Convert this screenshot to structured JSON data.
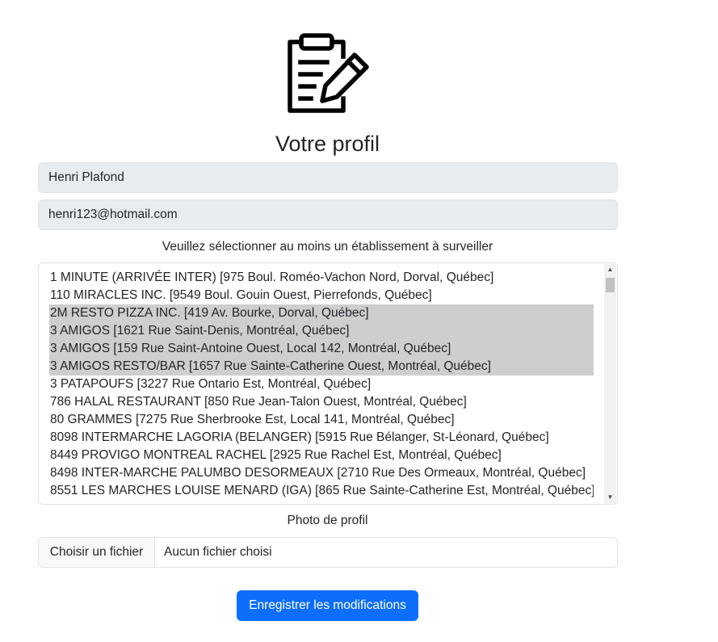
{
  "page": {
    "title": "Votre profil"
  },
  "form": {
    "name_value": "Henri Plafond",
    "email_value": "henri123@hotmail.com",
    "establishments_hint": "Veuillez sélectionner au moins un établissement à surveiller",
    "establishments": [
      {
        "label": "1 MINUTE (ARRIVÉE INTER) [975 Boul. Roméo-Vachon Nord, Dorval, Québec]",
        "selected": false
      },
      {
        "label": "110 MIRACLES INC. [9549 Boul. Gouin Ouest, Pierrefonds, Québec]",
        "selected": false
      },
      {
        "label": "2M RESTO PIZZA INC. [419 Av. Bourke, Dorval, Québec]",
        "selected": true
      },
      {
        "label": "3 AMIGOS [1621 Rue Saint-Denis, Montréal, Québec]",
        "selected": true
      },
      {
        "label": "3 AMIGOS [159 Rue Saint-Antoine Ouest, Local 142, Montréal, Québec]",
        "selected": true
      },
      {
        "label": "3 AMIGOS RESTO/BAR [1657 Rue Sainte-Catherine Ouest, Montréal, Québec]",
        "selected": true
      },
      {
        "label": "3 PATAPOUFS [3227 Rue Ontario Est, Montréal, Québec]",
        "selected": false
      },
      {
        "label": "786 HALAL RESTAURANT [850 Rue Jean-Talon Ouest, Montréal, Québec]",
        "selected": false
      },
      {
        "label": "80 GRAMMES [7275 Rue Sherbrooke Est, Local 141, Montréal, Québec]",
        "selected": false
      },
      {
        "label": "8098 INTERMARCHE LAGORIA (BELANGER) [5915 Rue Bélanger, St-Léonard, Québec]",
        "selected": false
      },
      {
        "label": "8449 PROVIGO MONTREAL RACHEL [2925 Rue Rachel Est, Montréal, Québec]",
        "selected": false
      },
      {
        "label": "8498 INTER-MARCHE PALUMBO DESORMEAUX [2710 Rue Des Ormeaux, Montréal, Québec]",
        "selected": false
      },
      {
        "label": "8551 LES MARCHES LOUISE MENARD (IGA) [865 Rue Sainte-Catherine Est, Montréal, Québec]",
        "selected": false
      }
    ],
    "photo_label": "Photo de profil",
    "file_button_label": "Choisir un fichier",
    "file_status": "Aucun fichier choisi",
    "save_label": "Enregistrer les modifications"
  },
  "icons": {
    "logo": "clipboard-edit-icon",
    "scroll_up": "triangle-up-icon",
    "scroll_down": "triangle-down-icon"
  },
  "colors": {
    "primary": "#0d6efd",
    "readonly_bg": "#e9ecef",
    "selected_bg": "#cecece"
  }
}
